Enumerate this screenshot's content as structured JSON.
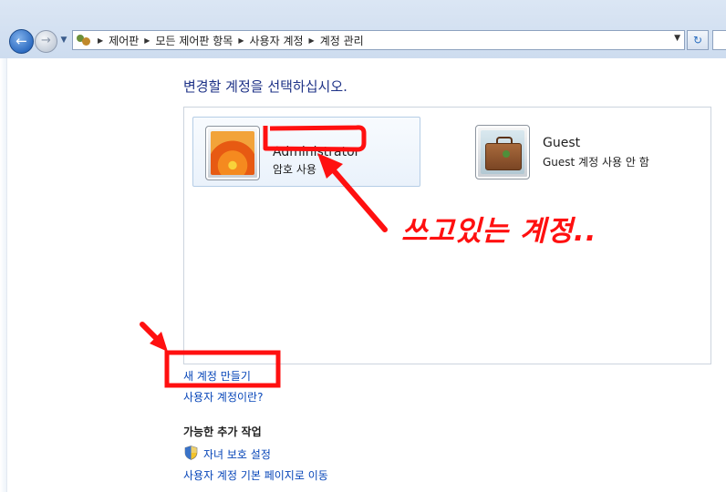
{
  "address_bar": {
    "breadcrumbs": [
      "제어판",
      "모든 제어판 항목",
      "사용자 계정",
      "계정 관리"
    ]
  },
  "main": {
    "title": "변경할 계정을 선택하십시오.",
    "accounts": [
      {
        "name": "Administrator",
        "status": "암호 사용",
        "avatar": "orange-flower-picture"
      },
      {
        "name": "Guest",
        "status": "Guest 계정 사용 안 함",
        "avatar": "briefcase-picture"
      }
    ],
    "links": {
      "create_account": "새 계정 만들기",
      "what_is_account": "사용자 계정이란?"
    },
    "additional": {
      "heading": "가능한 추가 작업",
      "parental_controls": "자녀 보호 설정",
      "user_accounts_home": "사용자 계정 기본 페이지로 이동"
    }
  },
  "annotation": {
    "label": "쓰고있는 계정..",
    "color": "#ff1010"
  },
  "icons": {
    "back": "back-arrow-icon",
    "forward": "forward-arrow-icon",
    "refresh": "refresh-icon",
    "shield": "uac-shield-icon",
    "users": "users-icon"
  }
}
